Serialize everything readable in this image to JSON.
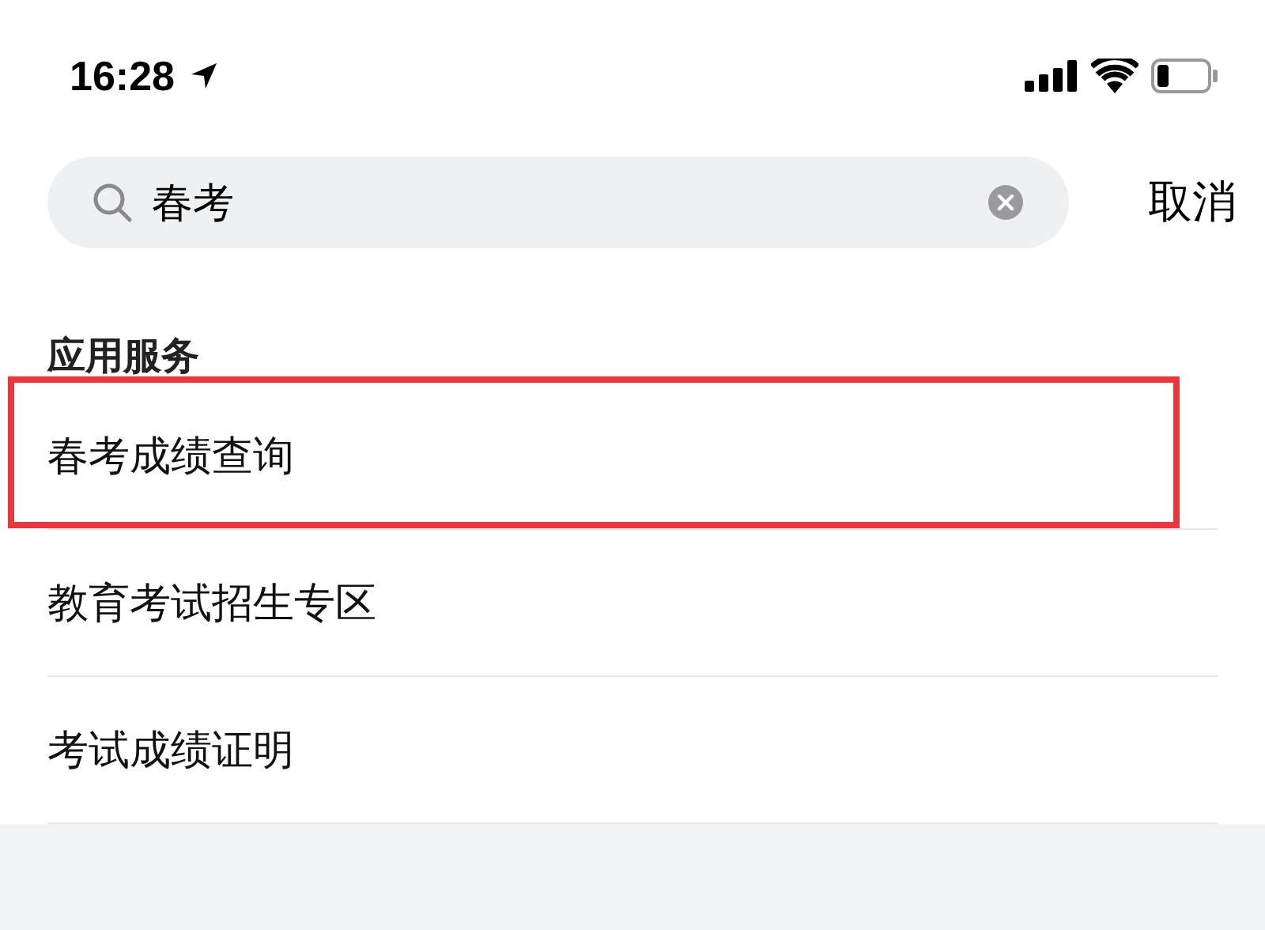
{
  "status_bar": {
    "time": "16:28"
  },
  "search": {
    "value": "春考"
  },
  "cancel": "取消",
  "section": {
    "title": "应用服务",
    "items": [
      {
        "label": "春考成绩查询",
        "highlighted": true
      },
      {
        "label": "教育考试招生专区",
        "highlighted": false
      },
      {
        "label": "考试成绩证明",
        "highlighted": false
      }
    ]
  }
}
